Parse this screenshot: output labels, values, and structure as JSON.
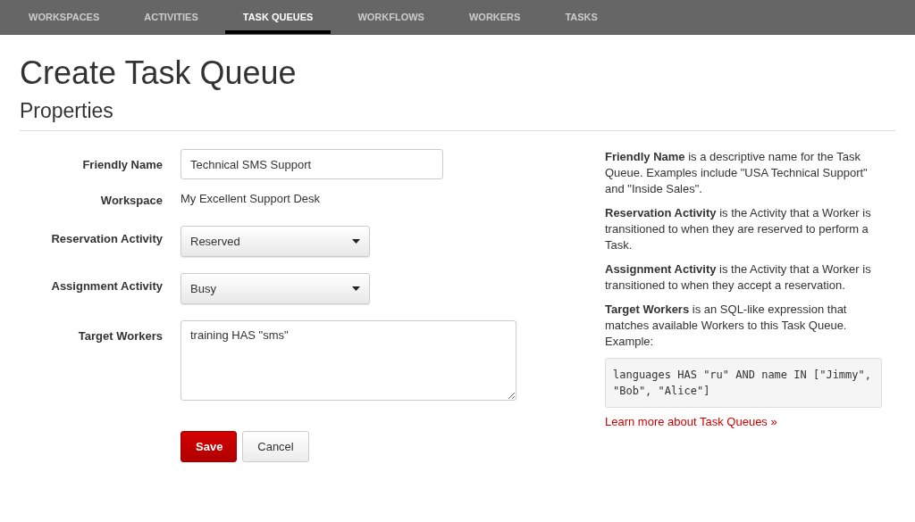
{
  "nav": {
    "tabs": [
      {
        "label": "WORKSPACES",
        "selected": false
      },
      {
        "label": "ACTIVITIES",
        "selected": false
      },
      {
        "label": "TASK QUEUES",
        "selected": true
      },
      {
        "label": "WORKFLOWS",
        "selected": false
      },
      {
        "label": "WORKERS",
        "selected": false
      },
      {
        "label": "TASKS",
        "selected": false
      }
    ]
  },
  "page": {
    "title": "Create Task Queue",
    "section": "Properties"
  },
  "form": {
    "fields": [
      {
        "kind": "text",
        "label": "Friendly Name",
        "value": "Technical SMS Support"
      },
      {
        "kind": "static",
        "label": "Workspace",
        "value": "My Excellent Support Desk"
      },
      {
        "kind": "select",
        "label": "Reservation Activity",
        "value": "Reserved"
      },
      {
        "kind": "select",
        "label": "Assignment Activity",
        "value": "Busy"
      },
      {
        "kind": "textarea",
        "label": "Target Workers",
        "value": "training HAS \"sms\""
      }
    ],
    "buttons": [
      {
        "kind": "primary",
        "label": "Save"
      },
      {
        "kind": "default",
        "label": "Cancel"
      }
    ]
  },
  "help": {
    "paragraphs": [
      "**Friendly Name** is a descriptive name for the Task Queue. Examples include \"USA Technical Support\" and \"Inside Sales\".",
      "**Reservation Activity** is the Activity that a Worker is transitioned to when they are reserved to perform a Task.",
      "**Assignment Activity** is the Activity that a Worker is transitioned to when they accept a reservation.",
      "**Target Workers** is an SQL-like expression that matches available Workers to this Task Queue. Example:"
    ],
    "code": "languages HAS \"ru\" AND name IN [\"Jimmy\", \"Bob\", \"Alice\"]",
    "link": "Learn more about Task Queues »"
  }
}
